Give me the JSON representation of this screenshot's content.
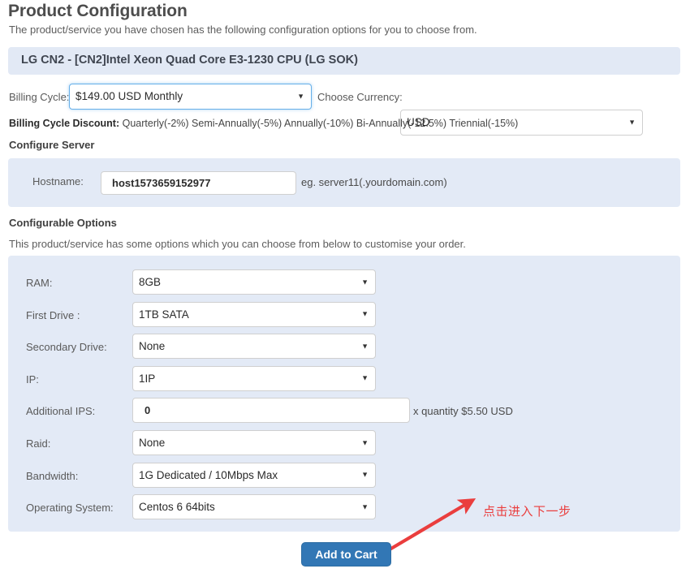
{
  "header": {
    "title": "Product Configuration",
    "subtitle": "The product/service you have chosen has the following configuration options for you to choose from."
  },
  "product_banner": {
    "label": "LG CN2 - [CN2]Intel Xeon Quad Core E3-1230 CPU (LG SOK)"
  },
  "billing": {
    "cycle_label": "Billing Cycle:",
    "cycle_value": "$149.00 USD Monthly",
    "currency_label": "Choose Currency:",
    "currency_value": "USD",
    "discount_title": "Billing Cycle Discount:",
    "discount_items": "Quarterly(-2%) Semi-Annually(-5%) Annually(-10%) Bi-Annually(-12.5%) Triennial(-15%)"
  },
  "configure_server": {
    "heading": "Configure Server",
    "hostname_label": "Hostname:",
    "hostname_value": "host1573659152977",
    "hostname_placeholder": "host1573659152977",
    "hostname_hint": "eg. server11(.yourdomain.com)"
  },
  "configurable_options": {
    "heading": "Configurable Options",
    "note": "This product/service has some options which you can choose from below to customise your order.",
    "rows": [
      {
        "label": "RAM:",
        "value": "8GB",
        "type": "select"
      },
      {
        "label": "First Drive :",
        "value": "1TB SATA",
        "type": "select"
      },
      {
        "label": "Secondary Drive:",
        "value": "None",
        "type": "select"
      },
      {
        "label": "IP:",
        "value": "1IP",
        "type": "select"
      },
      {
        "label": "Additional IPS:",
        "value": "0",
        "type": "text",
        "suffix": "x quantity $5.50 USD"
      },
      {
        "label": "Raid:",
        "value": "None",
        "type": "select"
      },
      {
        "label": "Bandwidth:",
        "value": "1G Dedicated / 10Mbps Max",
        "type": "select"
      },
      {
        "label": "Operating System:",
        "value": "Centos 6 64bits",
        "type": "select"
      }
    ]
  },
  "annotation": {
    "text": "点击进入下一步",
    "color": "#ea3e3e"
  },
  "footer": {
    "add_to_cart_label": "Add to Cart"
  },
  "icons": {
    "caret": "▼"
  },
  "colors": {
    "panel_bg": "#e3eaf6",
    "primary_button": "#3277b5",
    "annotation_red": "#ea3e3e",
    "focus_blue": "#66afe9"
  }
}
